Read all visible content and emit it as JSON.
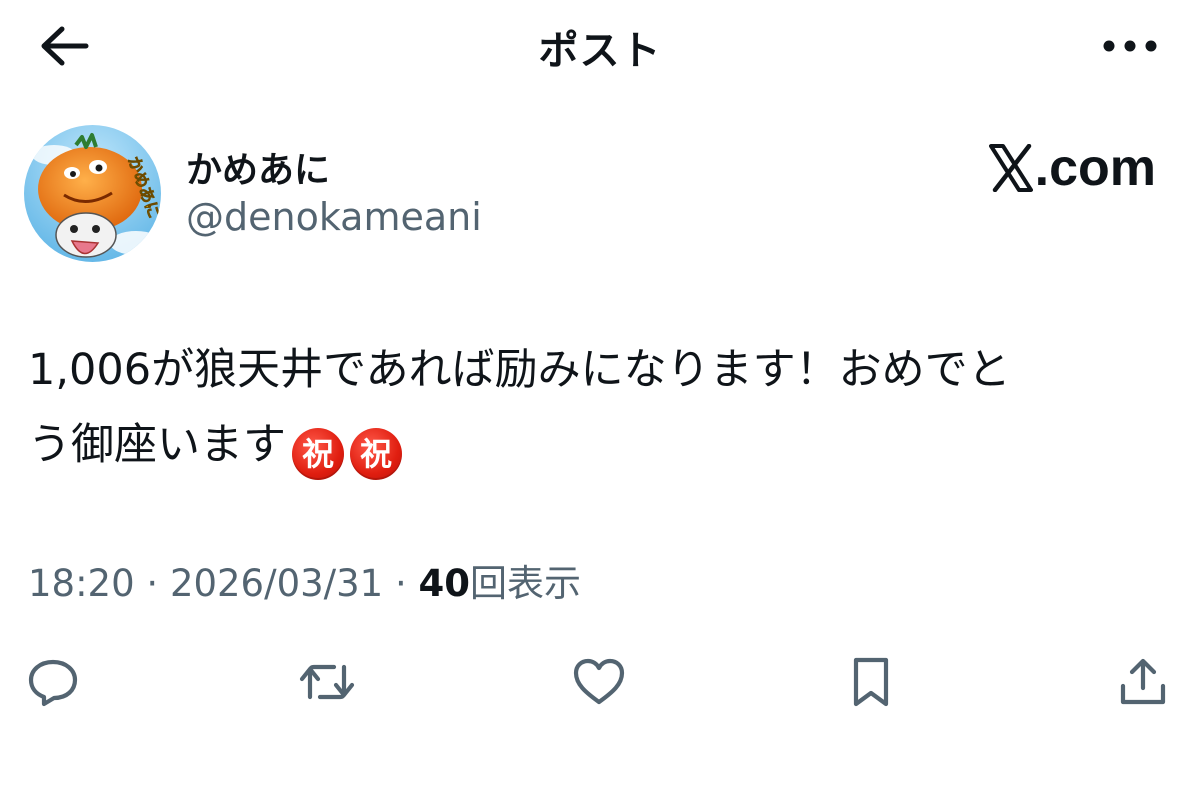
{
  "header": {
    "title": "ポスト",
    "back_icon": "arrow-left-icon",
    "more_icon": "more-horizontal-icon"
  },
  "author": {
    "name": "かめあに",
    "handle": "@denokameani",
    "avatar_text": "かめあに"
  },
  "watermark": {
    "text": ".com"
  },
  "post": {
    "text_line1": "1,006が狼天井であれば励みになります！おめでと",
    "text_line2": "う御座います",
    "emoji_1": "祝",
    "emoji_2": "祝"
  },
  "meta": {
    "time": "18:20",
    "separator_1": " · ",
    "date": "2026/03/31",
    "separator_2": " · ",
    "views_count": "40",
    "views_label": "回表示"
  },
  "actions": [
    {
      "icon": "reply-icon"
    },
    {
      "icon": "repost-icon"
    },
    {
      "icon": "like-icon"
    },
    {
      "icon": "bookmark-icon"
    },
    {
      "icon": "share-icon"
    }
  ],
  "colors": {
    "text_primary": "#0f1419",
    "text_secondary": "#536471",
    "emoji_red": "#e01e10"
  }
}
